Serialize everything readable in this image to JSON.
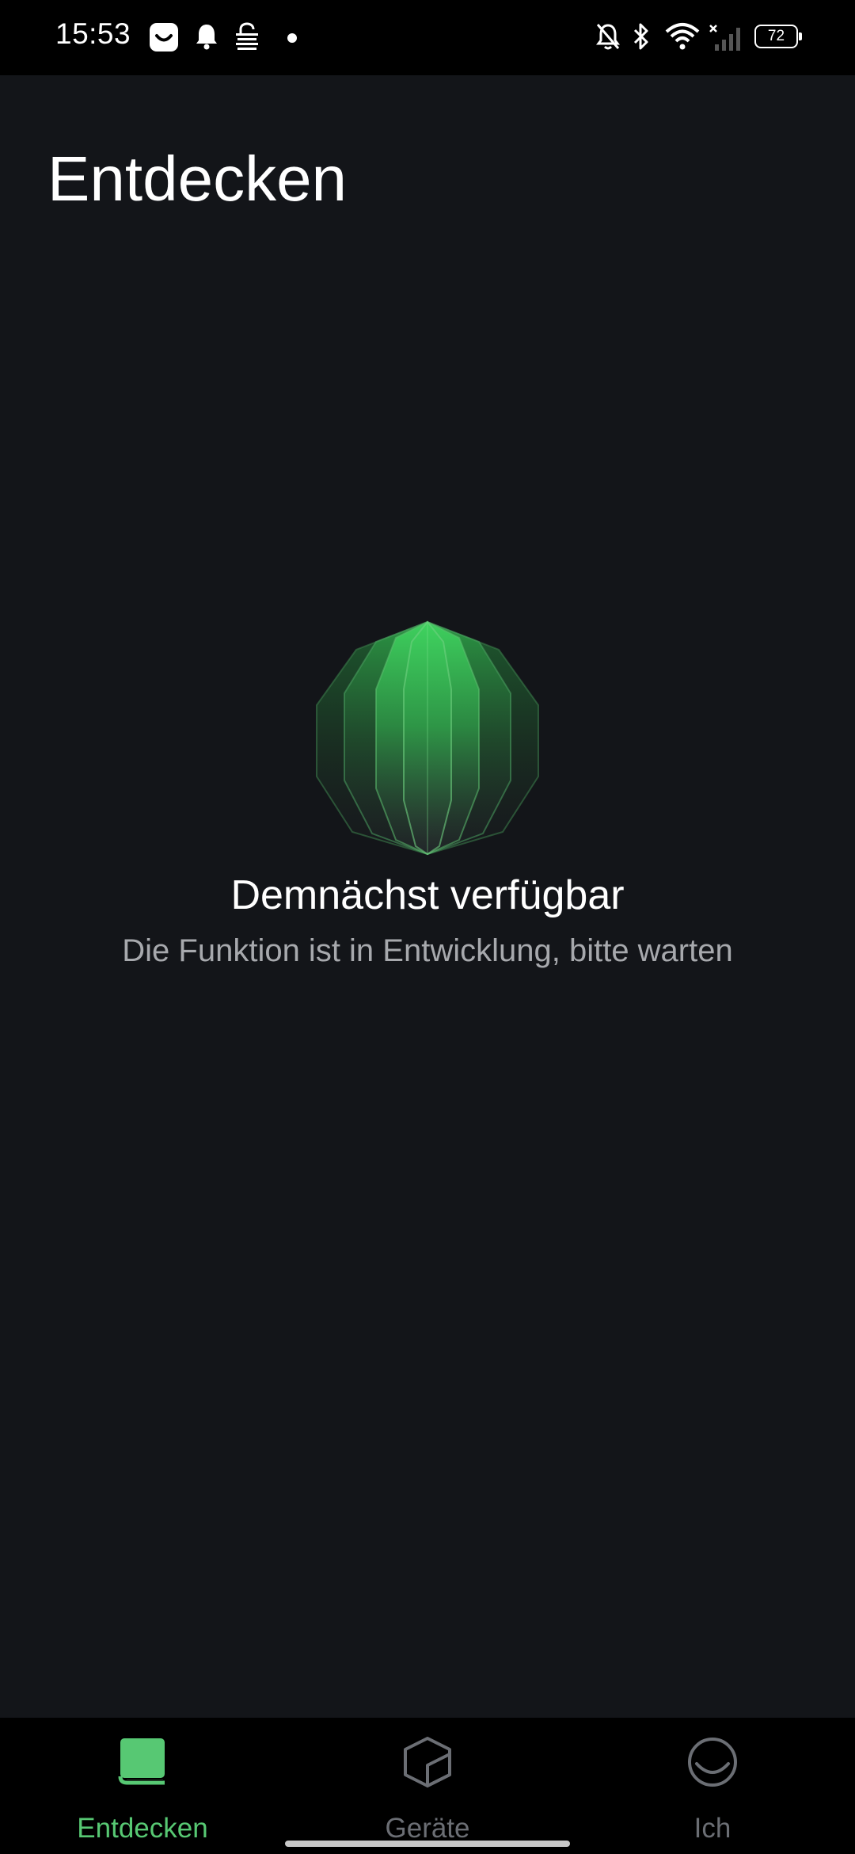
{
  "status_bar": {
    "time": "15:53",
    "battery_level": "72",
    "icons_left": [
      "smiley-app-icon",
      "bell-icon",
      "vpn-lock-icon",
      "dot-icon"
    ],
    "icons_right": [
      "bell-off-icon",
      "bluetooth-icon",
      "wifi-icon",
      "signal-x-icon"
    ]
  },
  "page": {
    "title": "Entdecken"
  },
  "empty_state": {
    "title": "Demnächst verfügbar",
    "subtitle": "Die Funktion ist in Entwicklung, bitte warten",
    "illustration": "green-polyhedron-icon"
  },
  "bottom_nav": {
    "items": [
      {
        "label": "Entdecken",
        "icon": "book-icon",
        "active": true
      },
      {
        "label": "Geräte",
        "icon": "cube-icon",
        "active": false
      },
      {
        "label": "Ich",
        "icon": "profile-circle-icon",
        "active": false
      }
    ]
  },
  "colors": {
    "accent": "#57c873",
    "background": "#131519",
    "nav_background": "#000000",
    "inactive": "#6b6e74",
    "subtitle": "#a7a9ad"
  }
}
